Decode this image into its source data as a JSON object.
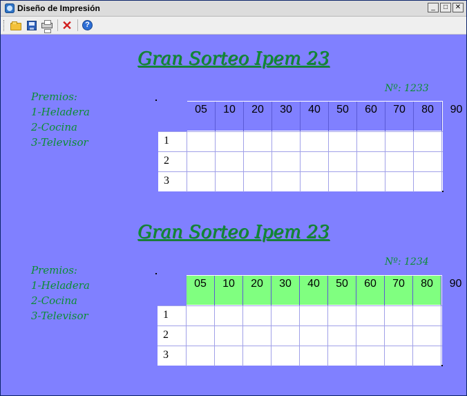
{
  "window": {
    "title": "Diseño de Impresión",
    "controls": {
      "minimize": "_",
      "maximize": "□",
      "close": "✕"
    }
  },
  "toolbar": {
    "items": [
      {
        "name": "open-folder-icon"
      },
      {
        "name": "save-disk-icon"
      },
      {
        "name": "printer-icon"
      },
      {
        "name": "delete-x-icon"
      },
      {
        "name": "help-icon",
        "glyph": "?"
      }
    ]
  },
  "colors": {
    "background": "#8080ff",
    "accent_text": "#0b8d34",
    "header_highlight": "#80ff80"
  },
  "tickets": [
    {
      "title": "Gran Sorteo Ipem 23",
      "serial": "Nº: 1233",
      "prizes": [
        "Premios:",
        "1-Heladera",
        "2-Cocina",
        "3-Televisor"
      ],
      "numbers": [
        "05",
        "10",
        "20",
        "30",
        "40",
        "50",
        "60",
        "70",
        "80",
        "90"
      ],
      "rows": [
        "1",
        "2",
        "3"
      ]
    },
    {
      "title": "Gran Sorteo Ipem 23",
      "serial": "Nº: 1234",
      "prizes": [
        "Premios:",
        "1-Heladera",
        "2-Cocina",
        "3-Televisor"
      ],
      "numbers": [
        "05",
        "10",
        "20",
        "30",
        "40",
        "50",
        "60",
        "70",
        "80",
        "90"
      ],
      "rows": [
        "1",
        "2",
        "3"
      ]
    }
  ]
}
